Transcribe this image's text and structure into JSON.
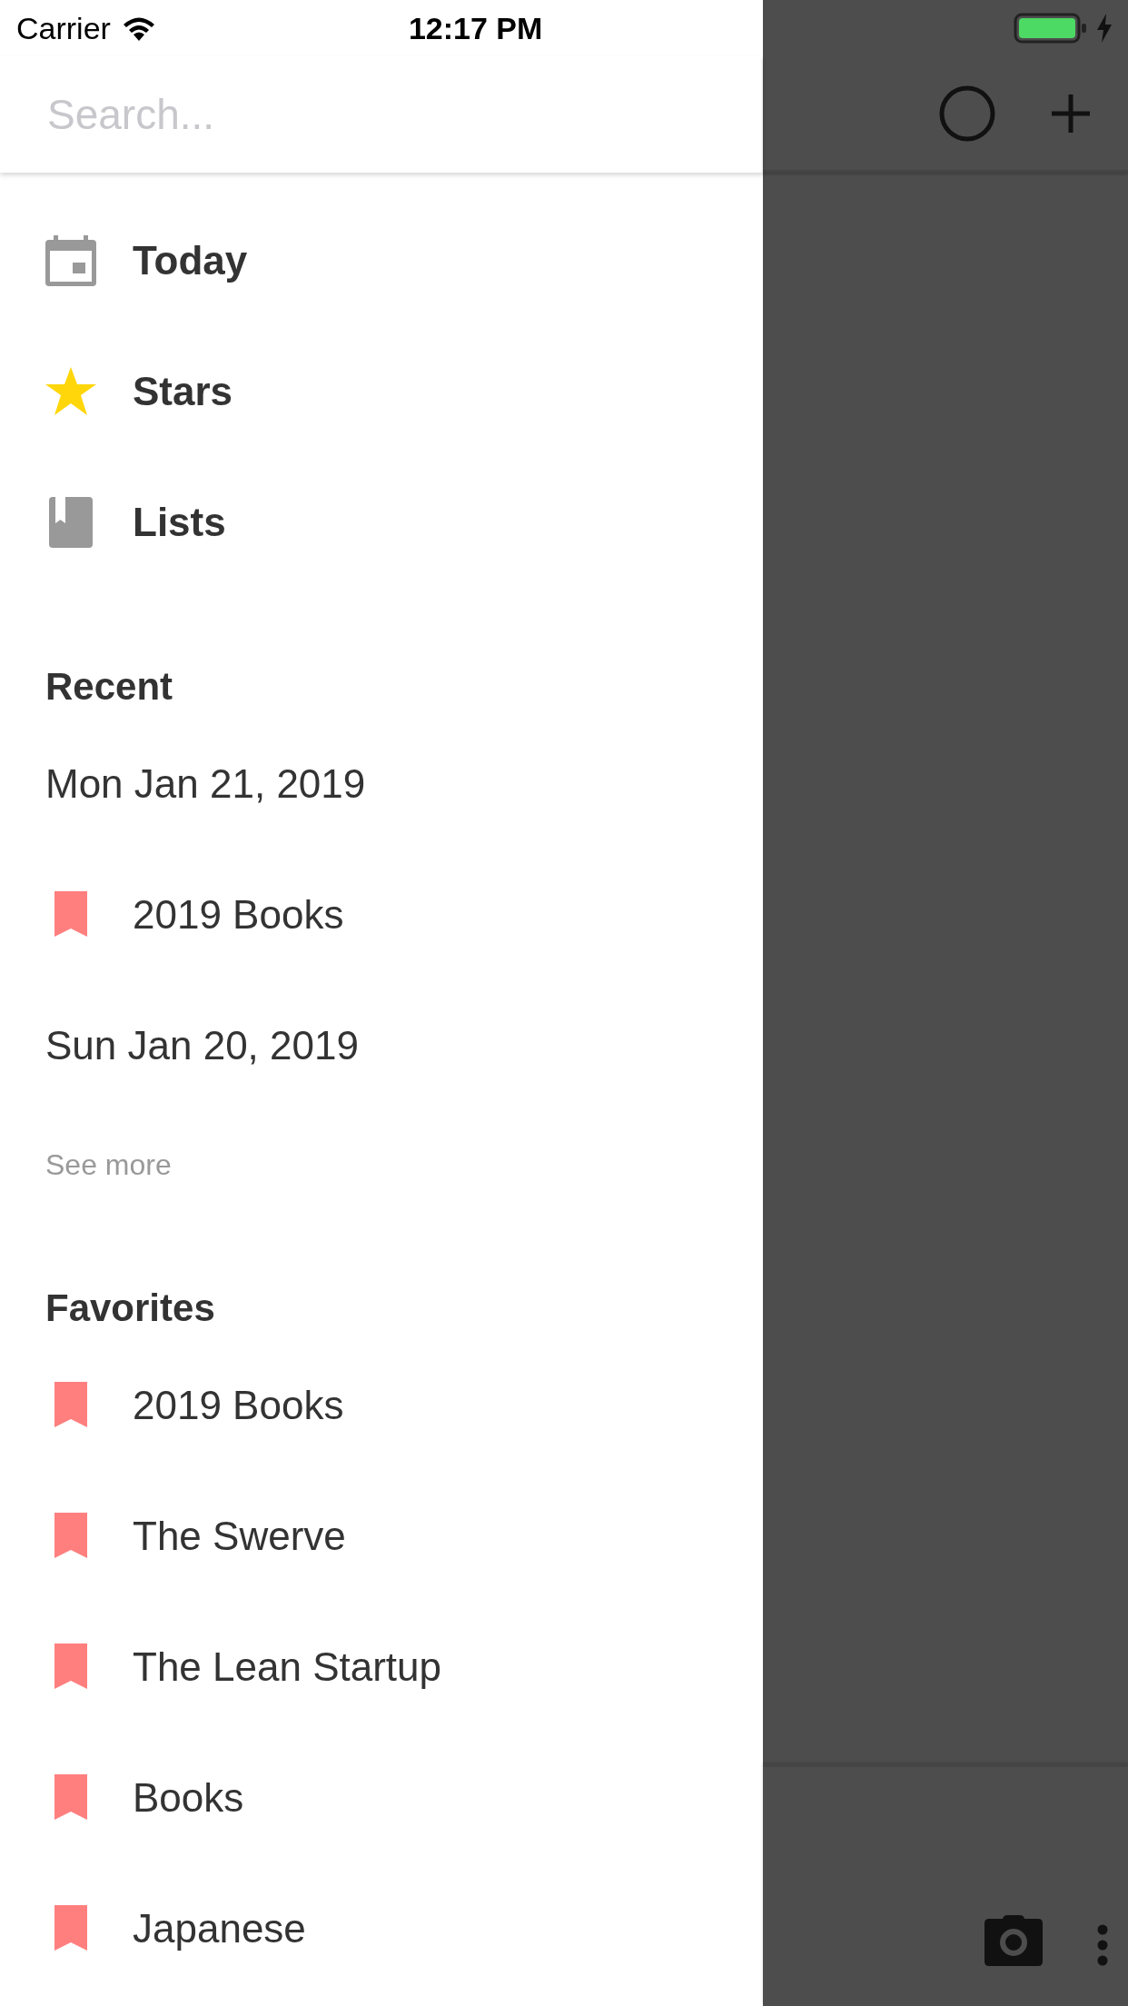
{
  "status_bar": {
    "carrier": "Carrier",
    "time": "12:17 PM"
  },
  "search": {
    "placeholder": "Search..."
  },
  "nav": [
    {
      "label": "Today",
      "kind": "calendar"
    },
    {
      "label": "Stars",
      "kind": "star"
    },
    {
      "label": "Lists",
      "kind": "book"
    }
  ],
  "recent": {
    "title": "Recent",
    "items": [
      {
        "label": "Mon Jan 21, 2019",
        "kind": "date"
      },
      {
        "label": "2019 Books",
        "kind": "list"
      },
      {
        "label": "Sun Jan 20, 2019",
        "kind": "date"
      }
    ],
    "see_more": "See more"
  },
  "favorites": {
    "title": "Favorites",
    "items": [
      {
        "label": "2019 Books"
      },
      {
        "label": "The Swerve"
      },
      {
        "label": "The Lean Startup"
      },
      {
        "label": "Books"
      },
      {
        "label": "Japanese"
      }
    ]
  }
}
